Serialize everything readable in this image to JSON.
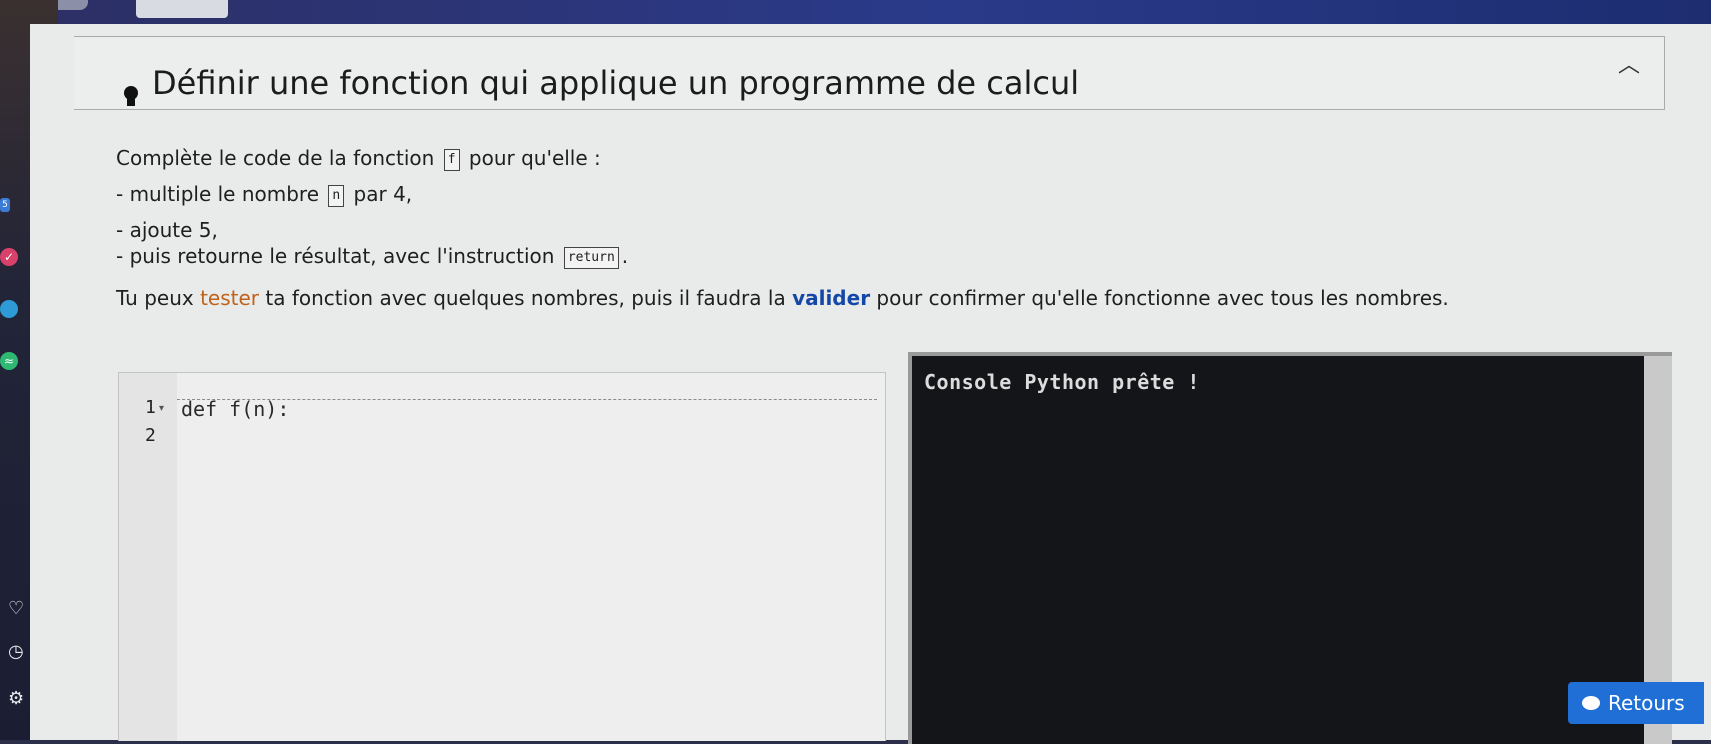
{
  "exercise": {
    "title": "Définir une fonction qui applique un programme de calcul",
    "instructions": {
      "line1_prefix": "Complète le code de la fonction",
      "line1_code": "f",
      "line1_suffix": "pour qu'elle :",
      "line2_prefix": "- multiple le nombre",
      "line2_code": "n",
      "line2_suffix": "par 4,",
      "line3": "- ajoute 5,",
      "line4_prefix": "- puis retourne le résultat, avec l'instruction",
      "line4_code": "return",
      "line4_suffix": ".",
      "line5_part1": "Tu peux",
      "line5_tester": "tester",
      "line5_part2": "ta fonction avec quelques nombres, puis il faudra la",
      "line5_valider": "valider",
      "line5_part3": "pour confirmer qu'elle fonctionne avec tous les nombres."
    }
  },
  "editor": {
    "lines": [
      {
        "number": "1",
        "code": "def f(n):"
      },
      {
        "number": "2",
        "code": ""
      }
    ]
  },
  "console": {
    "text": "Console Python prête !"
  },
  "feedback_button": {
    "label": "Retours"
  },
  "colors": {
    "tester": "#c0621a",
    "valider": "#1448a8",
    "console_bg": "#141518",
    "button": "#1f6fd6"
  }
}
